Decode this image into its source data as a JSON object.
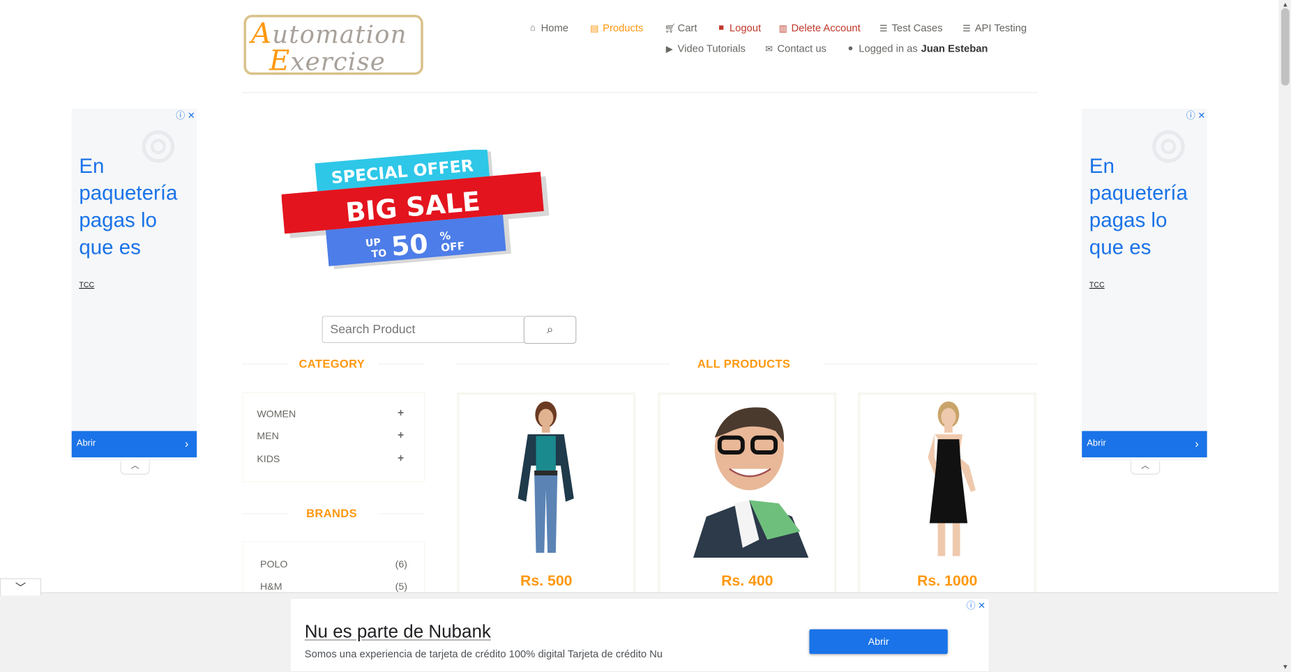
{
  "logo": {
    "line1_cap": "A",
    "line1_rest": "utomation",
    "line2_cap": "E",
    "line2_rest": "xercise"
  },
  "nav": {
    "home": "Home",
    "products": "Products",
    "cart": "Cart",
    "logout": "Logout",
    "delete_account": "Delete Account",
    "test_cases": "Test Cases",
    "api_testing": "API Testing",
    "video_tutorials": "Video Tutorials",
    "contact_us": "Contact us",
    "logged_in_prefix": "Logged in as",
    "logged_in_user": "Juan Esteban"
  },
  "side_ads": {
    "text": "En paquetería pagas lo que es",
    "brand": "TCC",
    "button": "Abrir"
  },
  "banner": {
    "line1": "SPECIAL OFFER",
    "line2": "BIG SALE",
    "up": "UP",
    "to": "TO",
    "percent": "50",
    "pct_sign": "%",
    "off": "OFF"
  },
  "search": {
    "placeholder": "Search Product"
  },
  "category": {
    "heading": "CATEGORY",
    "items": [
      "WOMEN",
      "MEN",
      "KIDS"
    ]
  },
  "brands": {
    "heading": "BRANDS",
    "items": [
      {
        "name": "POLO",
        "count": "(6)"
      },
      {
        "name": "H&M",
        "count": "(5)"
      }
    ]
  },
  "products": {
    "heading": "ALL PRODUCTS",
    "items": [
      {
        "price": "Rs. 500"
      },
      {
        "price": "Rs. 400"
      },
      {
        "price": "Rs. 1000"
      }
    ]
  },
  "bottom_ad": {
    "title": "Nu es parte de Nubank",
    "subtitle": "Somos una experiencia de tarjeta de crédito 100% digital Tarjeta de crédito Nu",
    "button": "Abrir"
  },
  "colors": {
    "accent": "#fe980f",
    "ad_blue": "#1a73e8",
    "danger": "#c0392b"
  }
}
